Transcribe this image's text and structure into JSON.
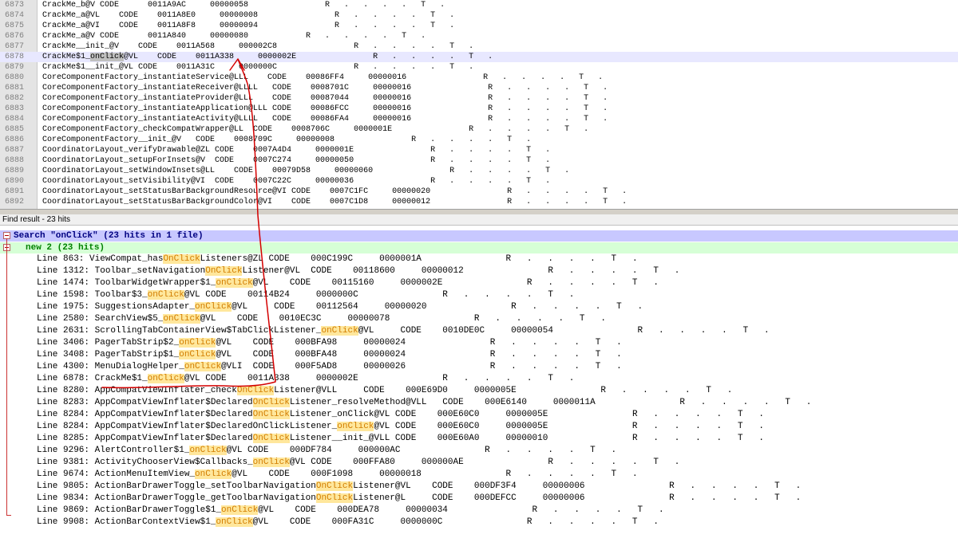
{
  "editor": {
    "lines": [
      {
        "num": "6873",
        "text": "CrackMe_b@V CODE      0011A9AC     00000058                R   .   .   .   .   T   ."
      },
      {
        "num": "6874",
        "text": "CrackMe_a@VL    CODE    0011A8E0     00000008                R   .   .   .   .   T   ."
      },
      {
        "num": "6875",
        "text": "CrackMe_a@VI    CODE    0011A8F8     00000094                R   .   .   .   .   T   ."
      },
      {
        "num": "6876",
        "text": "CrackMe_a@V CODE      0011A840     00000080            R   .   .   .   .   T   ."
      },
      {
        "num": "6877",
        "text": "CrackMe__init_@V    CODE    0011A568     000002C8                R   .   .   .   .   T   ."
      },
      {
        "num": "6878",
        "pre": "CrackMe$1_",
        "mid": "onClick",
        "post": "@VL    CODE    0011A338     0000002E                R   .   .   .   .   T   .",
        "hl": true
      },
      {
        "num": "6879",
        "text": "CrackMe$1__init_@VL CODE    0011A31C     0000000C                R   .   .   .   .   T   ."
      },
      {
        "num": "6880",
        "text": "CoreComponentFactory_instantiateService@LLL    CODE    00086FF4     00000016                R   .   .   .   .   T   ."
      },
      {
        "num": "6881",
        "text": "CoreComponentFactory_instantiateReceiver@LLLL   CODE    0008701C     00000016                R   .   .   .   .   T   ."
      },
      {
        "num": "6882",
        "text": "CoreComponentFactory_instantiateProvider@LLL    CODE    00087044     00000016                R   .   .   .   .   T   ."
      },
      {
        "num": "6883",
        "text": "CoreComponentFactory_instantiateApplication@LLL CODE    00086FCC     00000016                R   .   .   .   .   T   ."
      },
      {
        "num": "6884",
        "text": "CoreComponentFactory_instantiateActivity@LLLL   CODE    00086FA4     00000016                R   .   .   .   .   T   ."
      },
      {
        "num": "6885",
        "text": "CoreComponentFactory_checkCompatWrapper@LL  CODE    0008706C     0000001E                R   .   .   .   .   T   ."
      },
      {
        "num": "6886",
        "text": "CoreComponentFactory__init_@V   CODE    0008709C     00000008                R   .   .   .   .   T   ."
      },
      {
        "num": "6887",
        "text": "CoordinatorLayout_verifyDrawable@ZL CODE    0007A4D4     0000001E                R   .   .   .   .   T   ."
      },
      {
        "num": "6888",
        "text": "CoordinatorLayout_setupForInsets@V  CODE    0007C274     00000050                R   .   .   .   .   T   ."
      },
      {
        "num": "6889",
        "text": "CoordinatorLayout_setWindowInsets@LL    CODE    00079D58     00000060                R   .   .   .   .   T   ."
      },
      {
        "num": "6890",
        "text": "CoordinatorLayout_setVisibility@VI  CODE    0007C22C     00000036                R   .   .   .   .   T   ."
      },
      {
        "num": "6891",
        "text": "CoordinatorLayout_setStatusBarBackgroundResource@VI CODE    0007C1FC     00000020                R   .   .   .   .   T   ."
      },
      {
        "num": "6892",
        "text": "CoordinatorLayout_setStatusBarBackgroundColor@VI    CODE    0007C1D8     00000012                R   .   .   .   .   T   ."
      }
    ]
  },
  "find": {
    "title": "Find result - 23 hits",
    "search_label": "Search \"onClick\" (23 hits in 1 file)",
    "file_label": "new 2 (23 hits)",
    "keyword": "onClick",
    "results": [
      {
        "pre": "Line 863: ViewCompat_has",
        "mid": "OnClick",
        "post": "Listeners@ZL CODE    000C199C     0000001A                R   .   .   .   .   T   ."
      },
      {
        "pre": "Line 1312: Toolbar_setNavigation",
        "mid": "OnClick",
        "post": "Listener@VL  CODE    00118600     00000012                R   .   .   .   .   T   ."
      },
      {
        "pre": "Line 1474: ToolbarWidgetWrapper$1_",
        "mid": "onClick",
        "post": "@VL    CODE    00115160     0000002E                R   .   .   .   .   T   ."
      },
      {
        "pre": "Line 1598: Toolbar$3_",
        "mid": "onClick",
        "post": "@VL CODE    00114B24     0000000C                R   .   .   .   .   T   ."
      },
      {
        "pre": "Line 1975: SuggestionsAdapter_",
        "mid": "onClick",
        "post": "@VL     CODE    00112564     00000020                R   .   .   .   .   T   ."
      },
      {
        "pre": "Line 2580: SearchView$5_",
        "mid": "onClick",
        "post": "@VL    CODE    0010EC3C     00000078                R   .   .   .   .   T   ."
      },
      {
        "pre": "Line 2631: ScrollingTabContainerView$TabClickListener_",
        "mid": "onClick",
        "post": "@VL     CODE    0010DE0C     00000054                R   .   .   .   .   T   ."
      },
      {
        "pre": "Line 3406: PagerTabStrip$2_",
        "mid": "onClick",
        "post": "@VL    CODE    000BFA98     00000024                R   .   .   .   .   T   ."
      },
      {
        "pre": "Line 3408: PagerTabStrip$1_",
        "mid": "onClick",
        "post": "@VL    CODE    000BFA48     00000024                R   .   .   .   .   T   ."
      },
      {
        "pre": "Line 4300: MenuDialogHelper_",
        "mid": "onClick",
        "post": "@VLI  CODE    000F5AD8     00000026                R   .   .   .   .   T   ."
      },
      {
        "pre": "Line 6878: CrackMe$1_",
        "mid": "onClick",
        "post": "@VL CODE    0011A338     0000002E                R   .   .   .   .   T   ."
      },
      {
        "pre": "Line 8280: AppCompatViewInflater_check",
        "mid": "OnClick",
        "post": "Listener@VLL     CODE    000E69D0     0000005E                R   .   .   .   .   T   ."
      },
      {
        "pre": "Line 8283: AppCompatViewInflater$Declared",
        "mid": "OnClick",
        "post": "Listener_resolveMethod@VLL   CODE    000E6140     0000011A                R   .   .   .   .   T   ."
      },
      {
        "pre": "Line 8284: AppCompatViewInflater$Declared",
        "mid": "OnClick",
        "post": "Listener_onClick@VL CODE    000E60C0     0000005E                R   .   .   .   .   T   ."
      },
      {
        "pre": "Line 8284: AppCompatViewInflater$DeclaredOnClickListener_",
        "mid": "onClick",
        "post": "@VL CODE    000E60C0     0000005E                R   .   .   .   .   T   ."
      },
      {
        "pre": "Line 8285: AppCompatViewInflater$Declared",
        "mid": "OnClick",
        "post": "Listener__init_@VLL CODE    000E60A0     00000010                R   .   .   .   .   T   ."
      },
      {
        "pre": "Line 9296: AlertController$1_",
        "mid": "onClick",
        "post": "@VL CODE    000DF784     000000AC                R   .   .   .   .   T   ."
      },
      {
        "pre": "Line 9381: ActivityChooserView$Callbacks_",
        "mid": "onClick",
        "post": "@VL CODE    000FFA80     000000AE                R   .   .   .   .   T   ."
      },
      {
        "pre": "Line 9674: ActionMenuItemView_",
        "mid": "onClick",
        "post": "@VL    CODE    000F1098     00000018                R   .   .   .   .   T   ."
      },
      {
        "pre": "Line 9805: ActionBarDrawerToggle_setToolbarNavigation",
        "mid": "OnClick",
        "post": "Listener@VL    CODE    000DF3F4     00000006                R   .   .   .   .   T   ."
      },
      {
        "pre": "Line 9834: ActionBarDrawerToggle_getToolbarNavigation",
        "mid": "OnClick",
        "post": "Listener@L     CODE    000DEFCC     00000006                R   .   .   .   .   T   ."
      },
      {
        "pre": "Line 9869: ActionBarDrawerToggle$1_",
        "mid": "onClick",
        "post": "@VL    CODE    000DEA78     00000034                R   .   .   .   .   T   ."
      },
      {
        "pre": "Line 9908: ActionBarContextView$1_",
        "mid": "onClick",
        "post": "@VL    CODE    000FA31C     0000000C                R   .   .   .   .   T   ."
      }
    ]
  },
  "colors": {
    "highlight": "#ffe79c",
    "annotation": "#d40000"
  }
}
